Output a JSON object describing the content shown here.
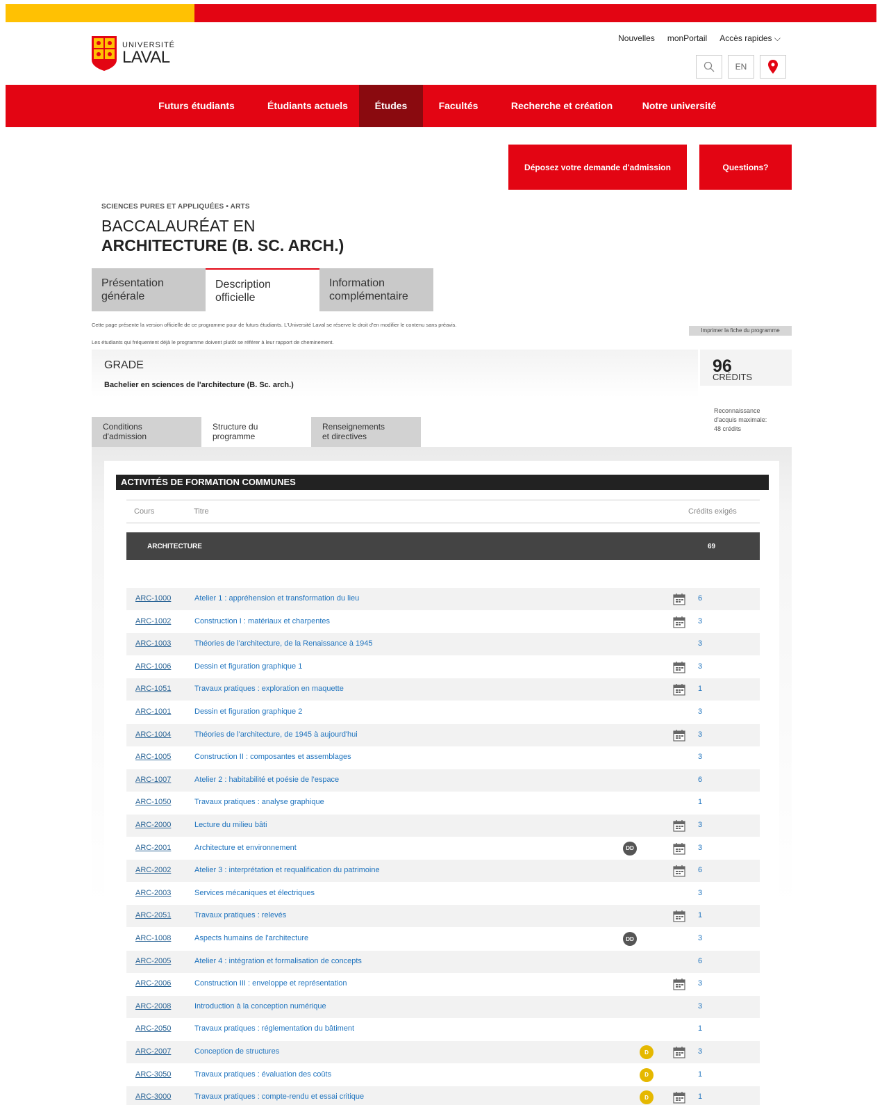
{
  "header": {
    "logo_top": "UNIVERSITÉ",
    "logo_bottom": "LAVAL",
    "utility_links": [
      "Nouvelles",
      "monPortail",
      "Accès rapides ⌵"
    ],
    "lang_label": "EN"
  },
  "nav": {
    "items": [
      "Futurs étudiants",
      "Étudiants actuels",
      "Études",
      "Facultés",
      "Recherche et création",
      "Notre université"
    ],
    "active": "Études"
  },
  "cta": {
    "admission": "Déposez votre demande d'admission",
    "questions": "Questions?"
  },
  "program": {
    "eyebrow": "SCIENCES PURES ET APPLIQUÉES • ARTS",
    "title_line1": "BACCALAURÉAT EN",
    "title_line2": "ARCHITECTURE (B. SC. ARCH.)"
  },
  "tabs_main": [
    {
      "l1": "Présentation",
      "l2": "générale"
    },
    {
      "l1": "Description",
      "l2": "officielle"
    },
    {
      "l1": "Information",
      "l2": "complémentaire"
    }
  ],
  "notice": {
    "line1": "Cette page présente la version officielle de ce programme pour de futurs étudiants. L'Université Laval se réserve le droit d'en modifier le contenu sans préavis.",
    "line2": "Les étudiants qui fréquentent déjà le programme doivent plutôt se référer à leur rapport de cheminement.",
    "print_button": "Imprimer la fiche du programme"
  },
  "grade": {
    "label": "GRADE",
    "value": "Bachelier en sciences de l'architecture (B. Sc. arch.)",
    "credits_number": "96",
    "credits_label": "CRÉDITS",
    "recognition_l1": "Reconnaissance",
    "recognition_l2": "d'acquis maximale:",
    "recognition_l3": "48 crédits"
  },
  "tabs_sub": [
    {
      "l1": "Conditions",
      "l2": "d'admission"
    },
    {
      "l1": "Structure du",
      "l2": "programme"
    },
    {
      "l1": "Renseignements",
      "l2": "et directives"
    }
  ],
  "table": {
    "section_title": "ACTIVITÉS DE FORMATION COMMUNES",
    "col_course": "Cours",
    "col_title": "Titre",
    "col_credits": "Crédits exigés",
    "group_name": "ARCHITECTURE",
    "group_credits": "69",
    "badge_dd": "DD",
    "badge_d": "D",
    "rows": [
      {
        "code": "ARC-1000",
        "title": "Atelier 1 : appréhension et transformation du lieu",
        "credits": "6",
        "cal": true,
        "badge": ""
      },
      {
        "code": "ARC-1002",
        "title": "Construction I : matériaux et charpentes",
        "credits": "3",
        "cal": true,
        "badge": ""
      },
      {
        "code": "ARC-1003",
        "title": "Théories de l'architecture, de la Renaissance à 1945",
        "credits": "3",
        "cal": false,
        "badge": ""
      },
      {
        "code": "ARC-1006",
        "title": "Dessin et figuration graphique 1",
        "credits": "3",
        "cal": true,
        "badge": ""
      },
      {
        "code": "ARC-1051",
        "title": "Travaux pratiques : exploration en maquette",
        "credits": "1",
        "cal": true,
        "badge": ""
      },
      {
        "code": "ARC-1001",
        "title": "Dessin et figuration graphique 2",
        "credits": "3",
        "cal": false,
        "badge": ""
      },
      {
        "code": "ARC-1004",
        "title": "Théories de l'architecture, de 1945 à aujourd'hui",
        "credits": "3",
        "cal": true,
        "badge": ""
      },
      {
        "code": "ARC-1005",
        "title": "Construction II : composantes et assemblages",
        "credits": "3",
        "cal": false,
        "badge": ""
      },
      {
        "code": "ARC-1007",
        "title": "Atelier 2 : habitabilité et poésie de l'espace",
        "credits": "6",
        "cal": false,
        "badge": ""
      },
      {
        "code": "ARC-1050",
        "title": "Travaux pratiques : analyse graphique",
        "credits": "1",
        "cal": false,
        "badge": ""
      },
      {
        "code": "ARC-2000",
        "title": "Lecture du milieu bâti",
        "credits": "3",
        "cal": true,
        "badge": ""
      },
      {
        "code": "ARC-2001",
        "title": "Architecture et environnement",
        "credits": "3",
        "cal": true,
        "badge": "dd"
      },
      {
        "code": "ARC-2002",
        "title": "Atelier 3 : interprétation et requalification du patrimoine",
        "credits": "6",
        "cal": true,
        "badge": ""
      },
      {
        "code": "ARC-2003",
        "title": "Services mécaniques et électriques",
        "credits": "3",
        "cal": false,
        "badge": ""
      },
      {
        "code": "ARC-2051",
        "title": "Travaux pratiques : relevés",
        "credits": "1",
        "cal": true,
        "badge": ""
      },
      {
        "code": "ARC-1008",
        "title": "Aspects humains de l'architecture",
        "credits": "3",
        "cal": false,
        "badge": "dd"
      },
      {
        "code": "ARC-2005",
        "title": "Atelier 4 : intégration et formalisation de concepts",
        "credits": "6",
        "cal": false,
        "badge": ""
      },
      {
        "code": "ARC-2006",
        "title": "Construction III : enveloppe et représentation",
        "credits": "3",
        "cal": true,
        "badge": ""
      },
      {
        "code": "ARC-2008",
        "title": "Introduction à la conception numérique",
        "credits": "3",
        "cal": false,
        "badge": ""
      },
      {
        "code": "ARC-2050",
        "title": "Travaux pratiques : réglementation du bâtiment",
        "credits": "1",
        "cal": false,
        "badge": ""
      },
      {
        "code": "ARC-2007",
        "title": "Conception de structures",
        "credits": "3",
        "cal": true,
        "badge": "d"
      },
      {
        "code": "ARC-3050",
        "title": "Travaux pratiques : évaluation des coûts",
        "credits": "1",
        "cal": false,
        "badge": "d"
      },
      {
        "code": "ARC-3000",
        "title": "Travaux pratiques : compte-rendu et essai critique",
        "credits": "1",
        "cal": true,
        "badge": "d"
      }
    ]
  },
  "colors": {
    "brand_red": "#e30513",
    "brand_yellow": "#ffc103",
    "active_nav": "#8a0a0f",
    "link_blue": "#1e73be"
  }
}
